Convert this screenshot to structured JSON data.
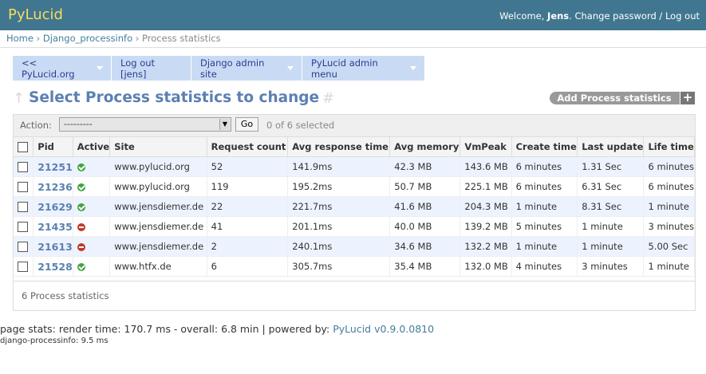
{
  "header": {
    "brand": "PyLucid",
    "welcome_prefix": "Welcome, ",
    "username": "Jens",
    "welcome_suffix": ".",
    "change_password": "Change password",
    "separator": " / ",
    "logout": "Log out"
  },
  "breadcrumb": {
    "home": "Home",
    "sep": " › ",
    "app": "Django_processinfo",
    "current": "Process statistics"
  },
  "admin_menu": {
    "items": [
      {
        "label": "<< PyLucid.org"
      },
      {
        "label": "Log out [jens]"
      },
      {
        "label": "Django admin site"
      },
      {
        "label": "PyLucid admin menu"
      }
    ]
  },
  "page": {
    "arrow": "↑",
    "title": "Select Process statistics to change",
    "hash": "#",
    "add_button": "Add Process statistics",
    "add_icon": "+"
  },
  "actions": {
    "label": "Action:",
    "select_value": "---------",
    "select_icon": "▼",
    "go": "Go",
    "selected": "0 of 6 selected"
  },
  "table": {
    "columns": [
      "Pid",
      "Active",
      "Site",
      "Request count",
      "Avg response time",
      "Avg memory",
      "VmPeak",
      "Create time",
      "Last update",
      "Life time"
    ],
    "rows": [
      {
        "pid": "21251",
        "active": true,
        "site": "www.pylucid.org",
        "request_count": "52",
        "avg_response": "141.9ms",
        "avg_memory": "42.3 MB",
        "vmpeak": "143.6 MB",
        "create_time": "6 minutes",
        "last_update": "1.31 Sec",
        "life_time": "6 minutes"
      },
      {
        "pid": "21236",
        "active": true,
        "site": "www.pylucid.org",
        "request_count": "119",
        "avg_response": "195.2ms",
        "avg_memory": "50.7 MB",
        "vmpeak": "225.1 MB",
        "create_time": "6 minutes",
        "last_update": "6.31 Sec",
        "life_time": "6 minutes"
      },
      {
        "pid": "21629",
        "active": true,
        "site": "www.jensdiemer.de",
        "request_count": "22",
        "avg_response": "221.7ms",
        "avg_memory": "41.6 MB",
        "vmpeak": "204.3 MB",
        "create_time": "1 minute",
        "last_update": "8.31 Sec",
        "life_time": "1 minute"
      },
      {
        "pid": "21435",
        "active": false,
        "site": "www.jensdiemer.de",
        "request_count": "41",
        "avg_response": "201.1ms",
        "avg_memory": "40.0 MB",
        "vmpeak": "139.2 MB",
        "create_time": "5 minutes",
        "last_update": "1 minute",
        "life_time": "3 minutes"
      },
      {
        "pid": "21613",
        "active": false,
        "site": "www.jensdiemer.de",
        "request_count": "2",
        "avg_response": "240.1ms",
        "avg_memory": "34.6 MB",
        "vmpeak": "132.2 MB",
        "create_time": "1 minute",
        "last_update": "1 minute",
        "life_time": "5.00 Sec"
      },
      {
        "pid": "21528",
        "active": true,
        "site": "www.htfx.de",
        "request_count": "6",
        "avg_response": "305.7ms",
        "avg_memory": "35.4 MB",
        "vmpeak": "132.0 MB",
        "create_time": "4 minutes",
        "last_update": "3 minutes",
        "life_time": "1 minute"
      }
    ],
    "footer": "6 Process statistics"
  },
  "footer": {
    "stats_text": "page stats: render time: 170.7 ms - overall: 6.8 min | powered by: ",
    "powered_link": "PyLucid v0.9.0.0810",
    "processinfo": "django-processinfo: 9.5 ms"
  },
  "colors": {
    "header_bg": "#417690",
    "brand": "#f5dd5d",
    "menu_bg": "#c9dbf4",
    "title": "#5b80b2",
    "active_yes": "#3fa43f",
    "active_no": "#c2392b",
    "row_alt": "#edf3fe"
  }
}
